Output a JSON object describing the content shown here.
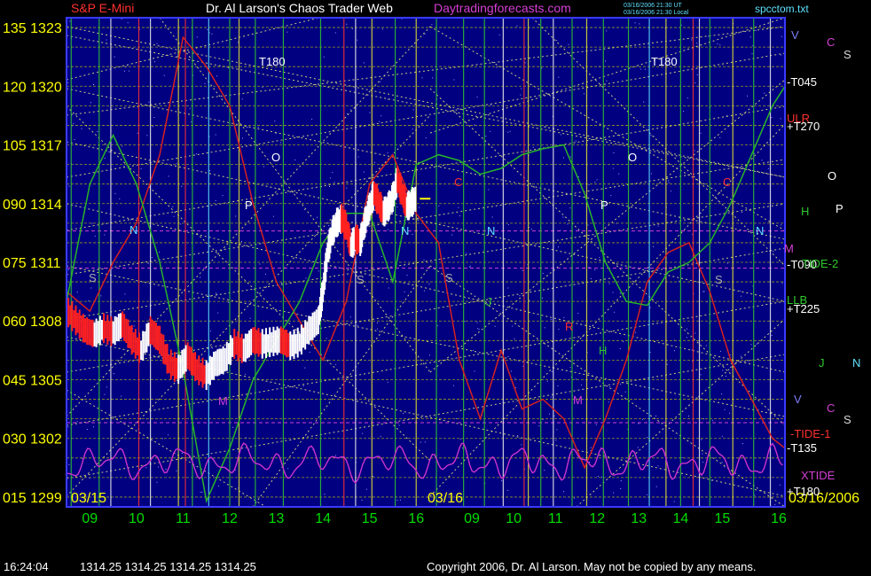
{
  "header": {
    "left_title": "S&P E-Mini",
    "center_title": "Dr. Al Larson's Chaos Trader Web",
    "site": "Daytradingforecasts.com",
    "file": "spcctom.txt",
    "update_line_1": "03/16/2006 21:30 UT",
    "update_line_2": "03/16/2006 21:30 Local"
  },
  "status": {
    "time": "16:24:04",
    "quote": "1314.25 1314.25 1314.25 1314.25",
    "copyright": "Copyright 2006, Dr. Al Larson. May not be copied by any means."
  },
  "colors": {
    "background": "#000000",
    "plot_area": "#000080",
    "frame": "#3a3aff",
    "price_up": "#ffffff",
    "price_down": "#ff2020",
    "grid_horizontal": "#cccc00",
    "grid_vertical_green": "#2ec82e",
    "grid_vertical_white": "#f0f0f0",
    "grid_vertical_red": "#ff3030",
    "grid_vertical_cyan": "#5fe0ff",
    "grid_vertical_yellow": "#e6e630",
    "tide_1": "#d62020",
    "tide_2": "#28b428",
    "xtide": "#cc33cc",
    "lines_dotted": "#c8c880",
    "y_labels": "#ffff00",
    "x_labels": "#00dd00"
  },
  "chart_data": {
    "type": "line",
    "title": "S&P E-Mini",
    "y_axis": {
      "prices": [
        1323,
        1320,
        1317,
        1314,
        1311,
        1308,
        1305,
        1302,
        1299
      ],
      "degrees": [
        "135",
        "120",
        "105",
        "090",
        "075",
        "060",
        "045",
        "030",
        "015"
      ],
      "labels": [
        "135 1323",
        "120 1320",
        "105 1317",
        "090 1314",
        "075 1311",
        "060 1308",
        "045 1305",
        "030 1302",
        "015 1299"
      ],
      "range": [
        1298.5,
        1323.5
      ]
    },
    "x_axis": {
      "hour_labels": [
        "09",
        "10",
        "11",
        "12",
        "13",
        "14",
        "15",
        "16",
        "09",
        "10",
        "11",
        "12",
        "13",
        "14",
        "15",
        "16"
      ],
      "date_labels": [
        "03/15",
        "03/16",
        "03/16/2006"
      ],
      "sessions": [
        "03/15",
        "03/16"
      ],
      "hours_per_session": [
        8.5,
        16.3
      ]
    },
    "series": [
      {
        "name": "S&P E-Mini",
        "kind": "price",
        "x": [
          8.5,
          8.7,
          8.9,
          9.1,
          9.3,
          9.5,
          9.7,
          9.9,
          10.1,
          10.3,
          10.5,
          10.7,
          10.9,
          11.1,
          11.3,
          11.5,
          11.7,
          11.9,
          12.1,
          12.3,
          12.5,
          12.7,
          12.9,
          13.1,
          13.3,
          13.5,
          13.7,
          13.9,
          14.0,
          14.1,
          14.2,
          14.3,
          14.4,
          14.5,
          14.6,
          14.7,
          14.8,
          14.9,
          15.0,
          15.1,
          15.2,
          15.3,
          15.4,
          15.5,
          15.6,
          15.7,
          15.8,
          15.9,
          16.0
        ],
        "values": [
          1308.5,
          1308.0,
          1307.5,
          1307.3,
          1307.6,
          1307.4,
          1307.8,
          1307.0,
          1306.5,
          1307.5,
          1307.0,
          1305.8,
          1305.5,
          1306.2,
          1305.5,
          1305.2,
          1305.8,
          1306.0,
          1306.8,
          1306.5,
          1307.0,
          1306.8,
          1306.9,
          1307.0,
          1306.7,
          1306.9,
          1307.5,
          1308.0,
          1309.5,
          1311.5,
          1312.5,
          1313.0,
          1313.2,
          1312.8,
          1311.8,
          1312.2,
          1312.0,
          1313.0,
          1313.8,
          1314.5,
          1314.0,
          1313.5,
          1313.8,
          1314.3,
          1315.2,
          1314.5,
          1313.8,
          1314.0,
          1314.25
        ]
      },
      {
        "name": "TIDE-1",
        "kind": "tide",
        "x": [
          8.5,
          9.0,
          9.5,
          10.0,
          10.5,
          11.0,
          11.5,
          12.0,
          12.5,
          13.0,
          13.5,
          14.0,
          14.5,
          15.0,
          15.5,
          16.0,
          16.5,
          17.0,
          17.5,
          18.0,
          18.5,
          19.0,
          19.5,
          20.0,
          20.5,
          21.0,
          21.5,
          22.0,
          22.5,
          23.0,
          23.5,
          24.0,
          24.5,
          24.8
        ],
        "values": [
          1309.5,
          1308.5,
          1311.0,
          1313.0,
          1316.5,
          1322.5,
          1321.0,
          1319.0,
          1314.0,
          1310.0,
          1308.0,
          1306.0,
          1309.0,
          1315.0,
          1316.5,
          1313.5,
          1312.0,
          1306.0,
          1303.0,
          1306.5,
          1303.5,
          1304.0,
          1303.0,
          1300.5,
          1303.0,
          1306.0,
          1310.0,
          1311.5,
          1312.0,
          1309.5,
          1306.0,
          1304.0,
          1302.0,
          1301.5
        ]
      },
      {
        "name": "TIDE-2",
        "kind": "tide",
        "x": [
          8.5,
          9.0,
          9.5,
          10.0,
          10.5,
          11.0,
          11.5,
          12.0,
          12.5,
          13.0,
          13.5,
          14.0,
          14.5,
          15.0,
          15.5,
          16.0,
          16.5,
          17.0,
          17.5,
          18.0,
          18.5,
          19.0,
          19.5,
          20.0,
          20.5,
          21.0,
          21.5,
          22.0,
          22.5,
          23.0,
          23.5,
          24.0,
          24.5,
          24.8
        ],
        "values": [
          1309.0,
          1315.0,
          1317.5,
          1315.0,
          1311.0,
          1305.5,
          1298.8,
          1301.5,
          1305.0,
          1307.0,
          1309.0,
          1312.0,
          1313.5,
          1313.5,
          1310.0,
          1316.0,
          1316.5,
          1316.2,
          1315.5,
          1315.8,
          1316.5,
          1316.8,
          1317.0,
          1314.5,
          1311.0,
          1309.0,
          1308.8,
          1310.5,
          1311.0,
          1312.0,
          1314.0,
          1316.5,
          1319.0,
          1320.0
        ]
      }
    ],
    "price_annotations": [
      "T180",
      "T180",
      "-T045",
      "+T270",
      "-T090",
      "+T225",
      "-T135",
      "+T180"
    ],
    "right_labels": [
      {
        "text": "V",
        "color": "#7d7dff"
      },
      {
        "text": "C",
        "color": "#d53fd5"
      },
      {
        "text": "S",
        "color": "#d8d8d8"
      },
      {
        "text": "-T045",
        "color": "#ffffff"
      },
      {
        "text": "ULR",
        "color": "#ff3030"
      },
      {
        "text": "+T270",
        "color": "#ffffff"
      },
      {
        "text": "O",
        "color": "#ffffff"
      },
      {
        "text": "H",
        "color": "#2ec82e"
      },
      {
        "text": "P",
        "color": "#ffffff"
      },
      {
        "text": "M",
        "color": "#d53fd5"
      },
      {
        "text": "-T090",
        "color": "#ffffff"
      },
      {
        "text": "TIDE-2",
        "color": "#2ec82e"
      },
      {
        "text": "LLB",
        "color": "#2ec82e"
      },
      {
        "text": "+T225",
        "color": "#ffffff"
      },
      {
        "text": "J",
        "color": "#2ec82e"
      },
      {
        "text": "N",
        "color": "#5fe0ff"
      },
      {
        "text": "V",
        "color": "#7d7dff"
      },
      {
        "text": "C",
        "color": "#d53fd5"
      },
      {
        "text": "S",
        "color": "#d8d8d8"
      },
      {
        "text": "-TIDE-1",
        "color": "#ff3030"
      },
      {
        "text": "-T135",
        "color": "#ffffff"
      },
      {
        "text": "XTIDE",
        "color": "#d53fd5"
      },
      {
        "text": "+T180",
        "color": "#ffffff"
      }
    ],
    "planet_marks": [
      {
        "text": "N",
        "color": "#5fe0ff"
      },
      {
        "text": "S",
        "color": "#aaaaaa"
      },
      {
        "text": "M",
        "color": "#d53fd5"
      },
      {
        "text": "O",
        "color": "#ffffff"
      },
      {
        "text": "P",
        "color": "#ffffff"
      },
      {
        "text": "N",
        "color": "#5fe0ff"
      },
      {
        "text": "S",
        "color": "#aaaaaa"
      },
      {
        "text": "C",
        "color": "#ff3030"
      },
      {
        "text": "N",
        "color": "#5fe0ff"
      },
      {
        "text": "S",
        "color": "#aaaaaa"
      },
      {
        "text": "J",
        "color": "#2ec82e"
      },
      {
        "text": "H",
        "color": "#2ec82e"
      },
      {
        "text": "R",
        "color": "#ff3030"
      },
      {
        "text": "M",
        "color": "#d53fd5"
      },
      {
        "text": "O",
        "color": "#ffffff"
      },
      {
        "text": "P",
        "color": "#ffffff"
      },
      {
        "text": "C",
        "color": "#ff3030"
      },
      {
        "text": "N",
        "color": "#5fe0ff"
      },
      {
        "text": "S",
        "color": "#aaaaaa"
      }
    ],
    "grid": true,
    "legend": "right"
  }
}
